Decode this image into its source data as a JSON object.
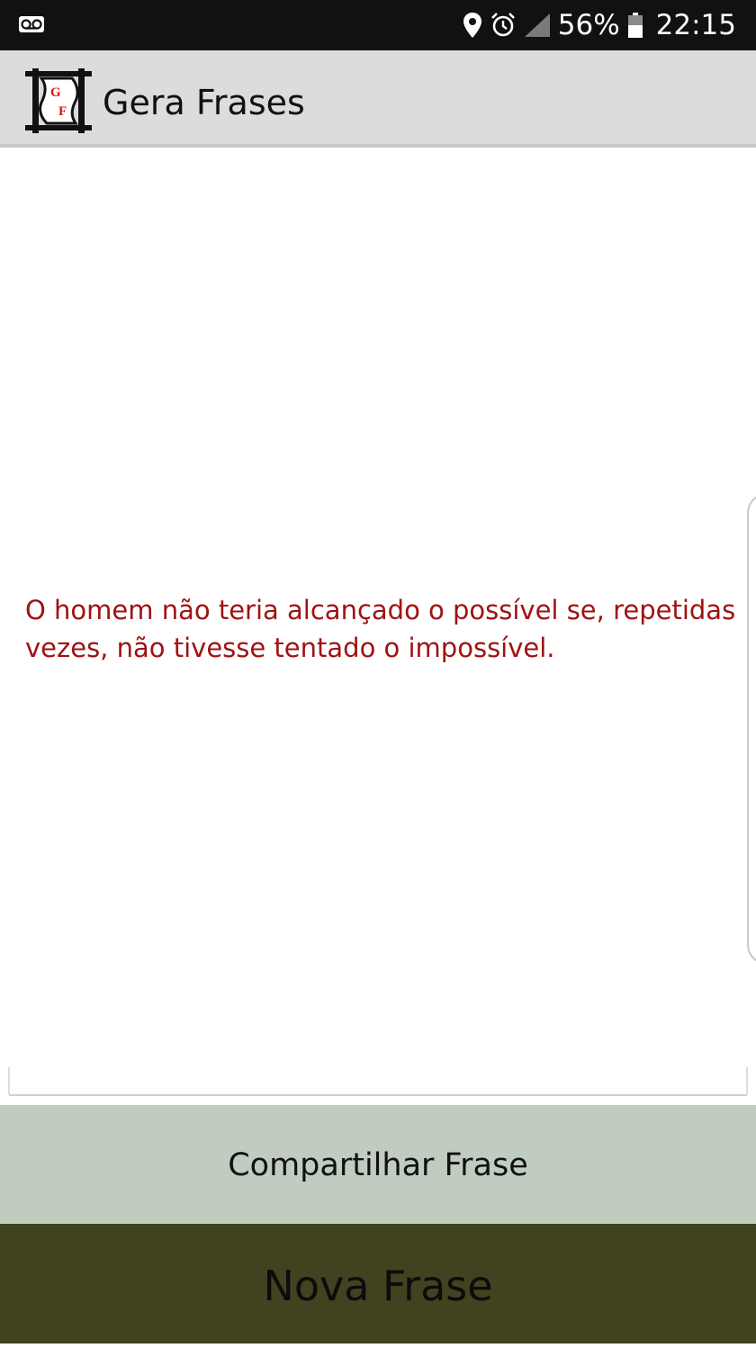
{
  "status_bar": {
    "left_icons": [
      "voicemail-icon"
    ],
    "right_icons": [
      "location-icon",
      "alarm-icon",
      "signal-icon"
    ],
    "battery_percent": "56%",
    "battery_icon": "battery-icon",
    "time": "22:15"
  },
  "app_bar": {
    "logo_icon": "app-logo-icon",
    "logo_letters": [
      "G",
      "F"
    ],
    "title": "Gera Frases"
  },
  "content": {
    "quote": "O homem não teria alcançado o possível se, repetidas vezes, não tivesse tentado o impossível."
  },
  "buttons": {
    "share_label": "Compartilhar Frase",
    "new_label": "Nova Frase"
  },
  "colors": {
    "status_bar_bg": "#111111",
    "app_bar_bg": "#dcdcdc",
    "quote_text": "#a01212",
    "share_button_bg": "#c1ccc1",
    "new_button_bg": "#41421f",
    "logo_accent": "#e01010"
  }
}
